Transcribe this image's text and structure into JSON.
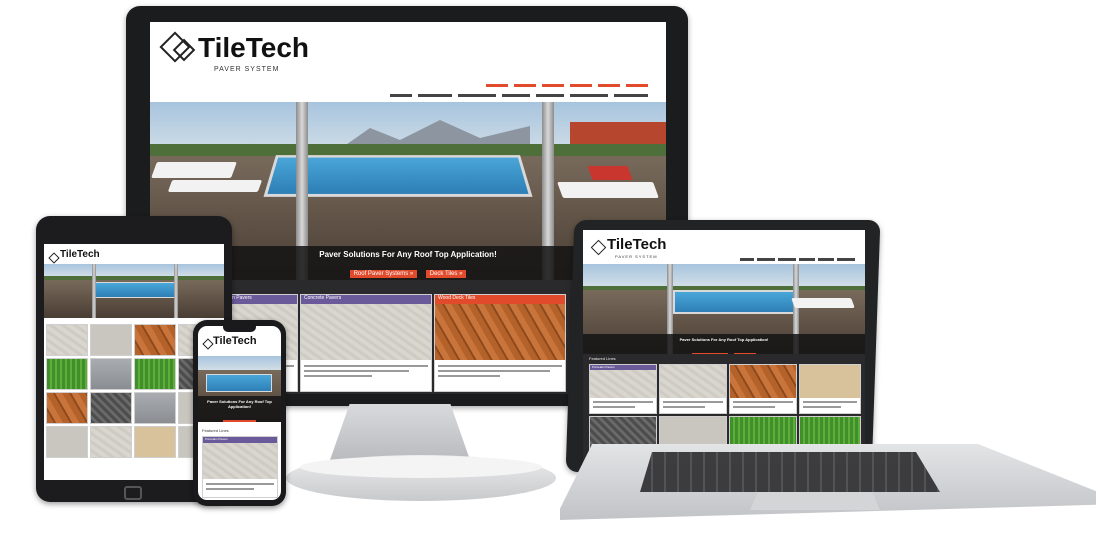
{
  "brand": {
    "name": "TileTech",
    "tagline": "PAVER SYSTEM"
  },
  "hero": {
    "title": "Paver Solutions For Any Roof Top Application!",
    "buttons": [
      "Roof Paver Systems »",
      "Deck Tiles »"
    ]
  },
  "sections": {
    "featured_lines": "Featured Lines"
  },
  "tiles": [
    {
      "title": "Porcelain Pavers"
    },
    {
      "title": "Concrete Pavers"
    },
    {
      "title": "Wood Deck Tiles"
    }
  ],
  "colors": {
    "accent": "#e24a2c",
    "tile_bar": "#6b5a9a",
    "bezel": "#1b1c1e"
  }
}
